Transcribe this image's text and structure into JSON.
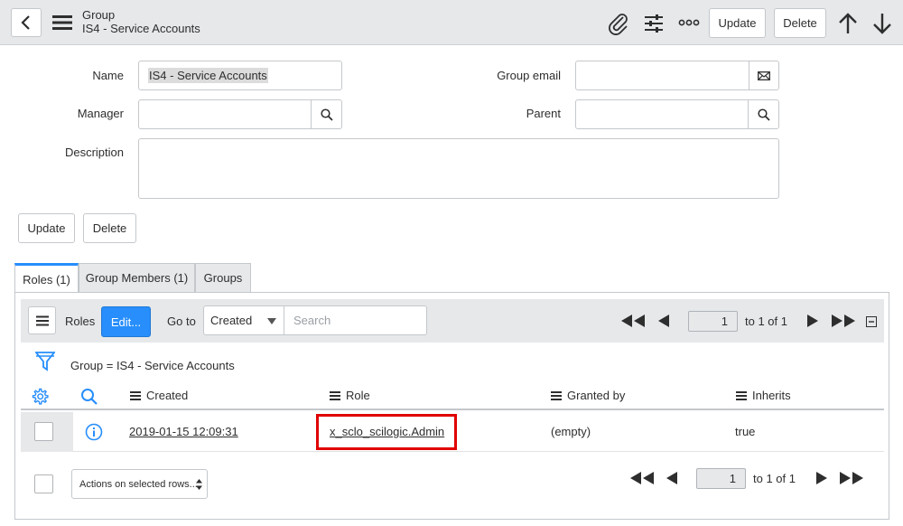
{
  "header": {
    "title": "Group",
    "subtitle": "IS4 - Service Accounts",
    "update_label": "Update",
    "delete_label": "Delete"
  },
  "form": {
    "name_label": "Name",
    "name_value": "IS4 - Service Accounts",
    "manager_label": "Manager",
    "manager_value": "",
    "description_label": "Description",
    "description_value": "",
    "group_email_label": "Group email",
    "group_email_value": "",
    "parent_label": "Parent",
    "parent_value": "",
    "update_label": "Update",
    "delete_label": "Delete"
  },
  "tabs": [
    {
      "label": "Roles (1)",
      "active": true
    },
    {
      "label": "Group Members (1)",
      "active": false
    },
    {
      "label": "Groups",
      "active": false
    }
  ],
  "list": {
    "title": "Roles",
    "edit_label": "Edit...",
    "goto_label": "Go to",
    "goto_selected": "Created",
    "search_placeholder": "Search",
    "page_value": "1",
    "page_of": "to 1 of 1",
    "filter_text": "Group = IS4 - Service Accounts",
    "columns": [
      "Created",
      "Role",
      "Granted by",
      "Inherits"
    ],
    "rows": [
      {
        "created": "2019-01-15 12:09:31",
        "role": "x_sclo_scilogic.Admin",
        "granted_by": "(empty)",
        "inherits": "true"
      }
    ],
    "actions_label": "Actions on selected rows...",
    "bottom_page_value": "1",
    "bottom_page_of": "to 1 of 1"
  },
  "colors": {
    "header_bg": "#e6e8ea",
    "accent_blue": "#278efc",
    "highlight_red": "#e00000"
  }
}
